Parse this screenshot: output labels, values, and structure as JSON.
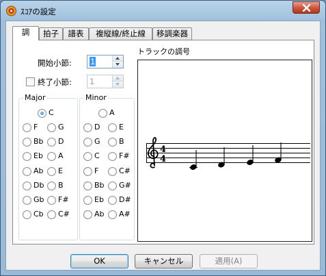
{
  "window": {
    "title": "ｽｺｱの設定"
  },
  "tabs": [
    {
      "label": "調",
      "active": true
    },
    {
      "label": "拍子",
      "active": false
    },
    {
      "label": "譜表",
      "active": false
    },
    {
      "label": "複縦線/終止線",
      "active": false
    },
    {
      "label": "移調楽器",
      "active": false
    }
  ],
  "start_measure": {
    "label": "開始小節:",
    "value": "1"
  },
  "end_measure": {
    "label": "終了小節:",
    "value": "1",
    "checked": false,
    "enabled": false
  },
  "major": {
    "title": "Major",
    "center": {
      "label": "C",
      "selected": true
    },
    "left": [
      "F",
      "Bb",
      "Eb",
      "Ab",
      "Db",
      "Gb",
      "Cb"
    ],
    "right": [
      "G",
      "D",
      "A",
      "E",
      "B",
      "F#",
      "C#"
    ]
  },
  "minor": {
    "title": "Minor",
    "center": {
      "label": "A",
      "selected": false
    },
    "left": [
      "D",
      "G",
      "C",
      "F",
      "Bb",
      "Eb",
      "Ab"
    ],
    "right": [
      "E",
      "B",
      "F#",
      "C#",
      "G#",
      "D#",
      "A#"
    ]
  },
  "preview": {
    "label": "トラックの調号",
    "time_signature": "4/4",
    "clef": "treble-clef-icon"
  },
  "buttons": {
    "ok": "OK",
    "cancel": "キャンセル",
    "apply": "適用(A)"
  },
  "colors": {
    "title_bar": "#a9c8e4",
    "close_button": "#cf5a3f",
    "radio_dot": "#1470c6"
  }
}
